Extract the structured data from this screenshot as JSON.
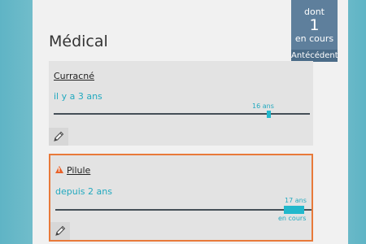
{
  "page": {
    "title": "Médical"
  },
  "counter": {
    "prefix": "dont",
    "count": "1",
    "suffix": "en cours",
    "footer": "Antécédent"
  },
  "cards": [
    {
      "name": "Curracné",
      "duration": "il y a 3 ans",
      "marker_label": "16 ans"
    },
    {
      "name": "Pilule",
      "duration": "depuis 2 ans",
      "marker_label": "17 ans",
      "status": "en cours"
    }
  ],
  "colors": {
    "accent": "#22a9bf",
    "warning": "#e87a3a",
    "counter_bg": "#5e7f9c"
  },
  "icons": {
    "edit": "pencil-icon",
    "warning": "warning-icon"
  }
}
